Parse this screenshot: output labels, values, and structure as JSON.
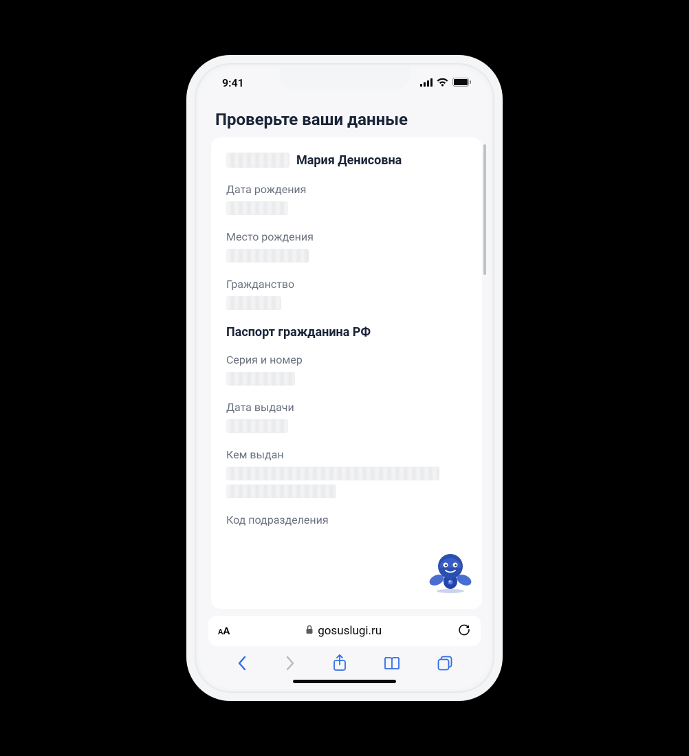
{
  "status": {
    "time": "9:41"
  },
  "page": {
    "title": "Проверьте ваши данные"
  },
  "person": {
    "name_visible": "Мария Денисовна"
  },
  "fields": {
    "dob_label": "Дата рождения",
    "pob_label": "Место рождения",
    "citizenship_label": "Гражданство"
  },
  "passport": {
    "section_title": "Паспорт гражданина РФ",
    "series_label": "Серия и номер",
    "issue_date_label": "Дата выдачи",
    "issued_by_label": "Кем выдан",
    "dept_code_label": "Код подразделения"
  },
  "browser": {
    "domain": "gosuslugi.ru",
    "aa_label": "AA"
  }
}
